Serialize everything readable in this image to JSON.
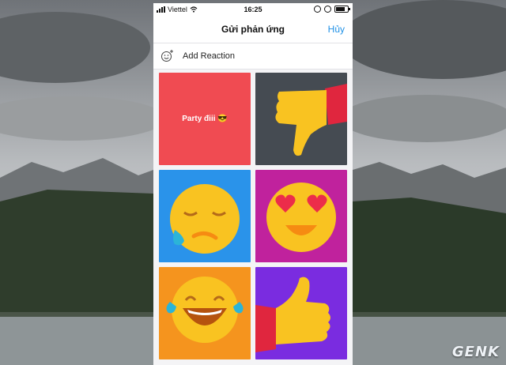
{
  "status_bar": {
    "carrier": "Viettel",
    "time": "16:25"
  },
  "header": {
    "title": "Gửi phản ứng",
    "cancel_label": "Hủy"
  },
  "add_reaction": {
    "label": "Add Reaction",
    "icon": "smiley-add-icon"
  },
  "reactions": [
    {
      "text": "Party điii 😎",
      "color": "#f04b52"
    },
    {
      "icon": "thumbs-down",
      "color": "#454b52"
    },
    {
      "icon": "sad-tear-face",
      "color": "#2a93ea"
    },
    {
      "icon": "heart-eyes-face",
      "color": "#c0229d"
    },
    {
      "icon": "tears-of-joy-face",
      "color": "#f5941e"
    },
    {
      "icon": "thumbs-up",
      "color": "#7a2ce0"
    }
  ],
  "watermark": {
    "logo_text": "GENK"
  }
}
